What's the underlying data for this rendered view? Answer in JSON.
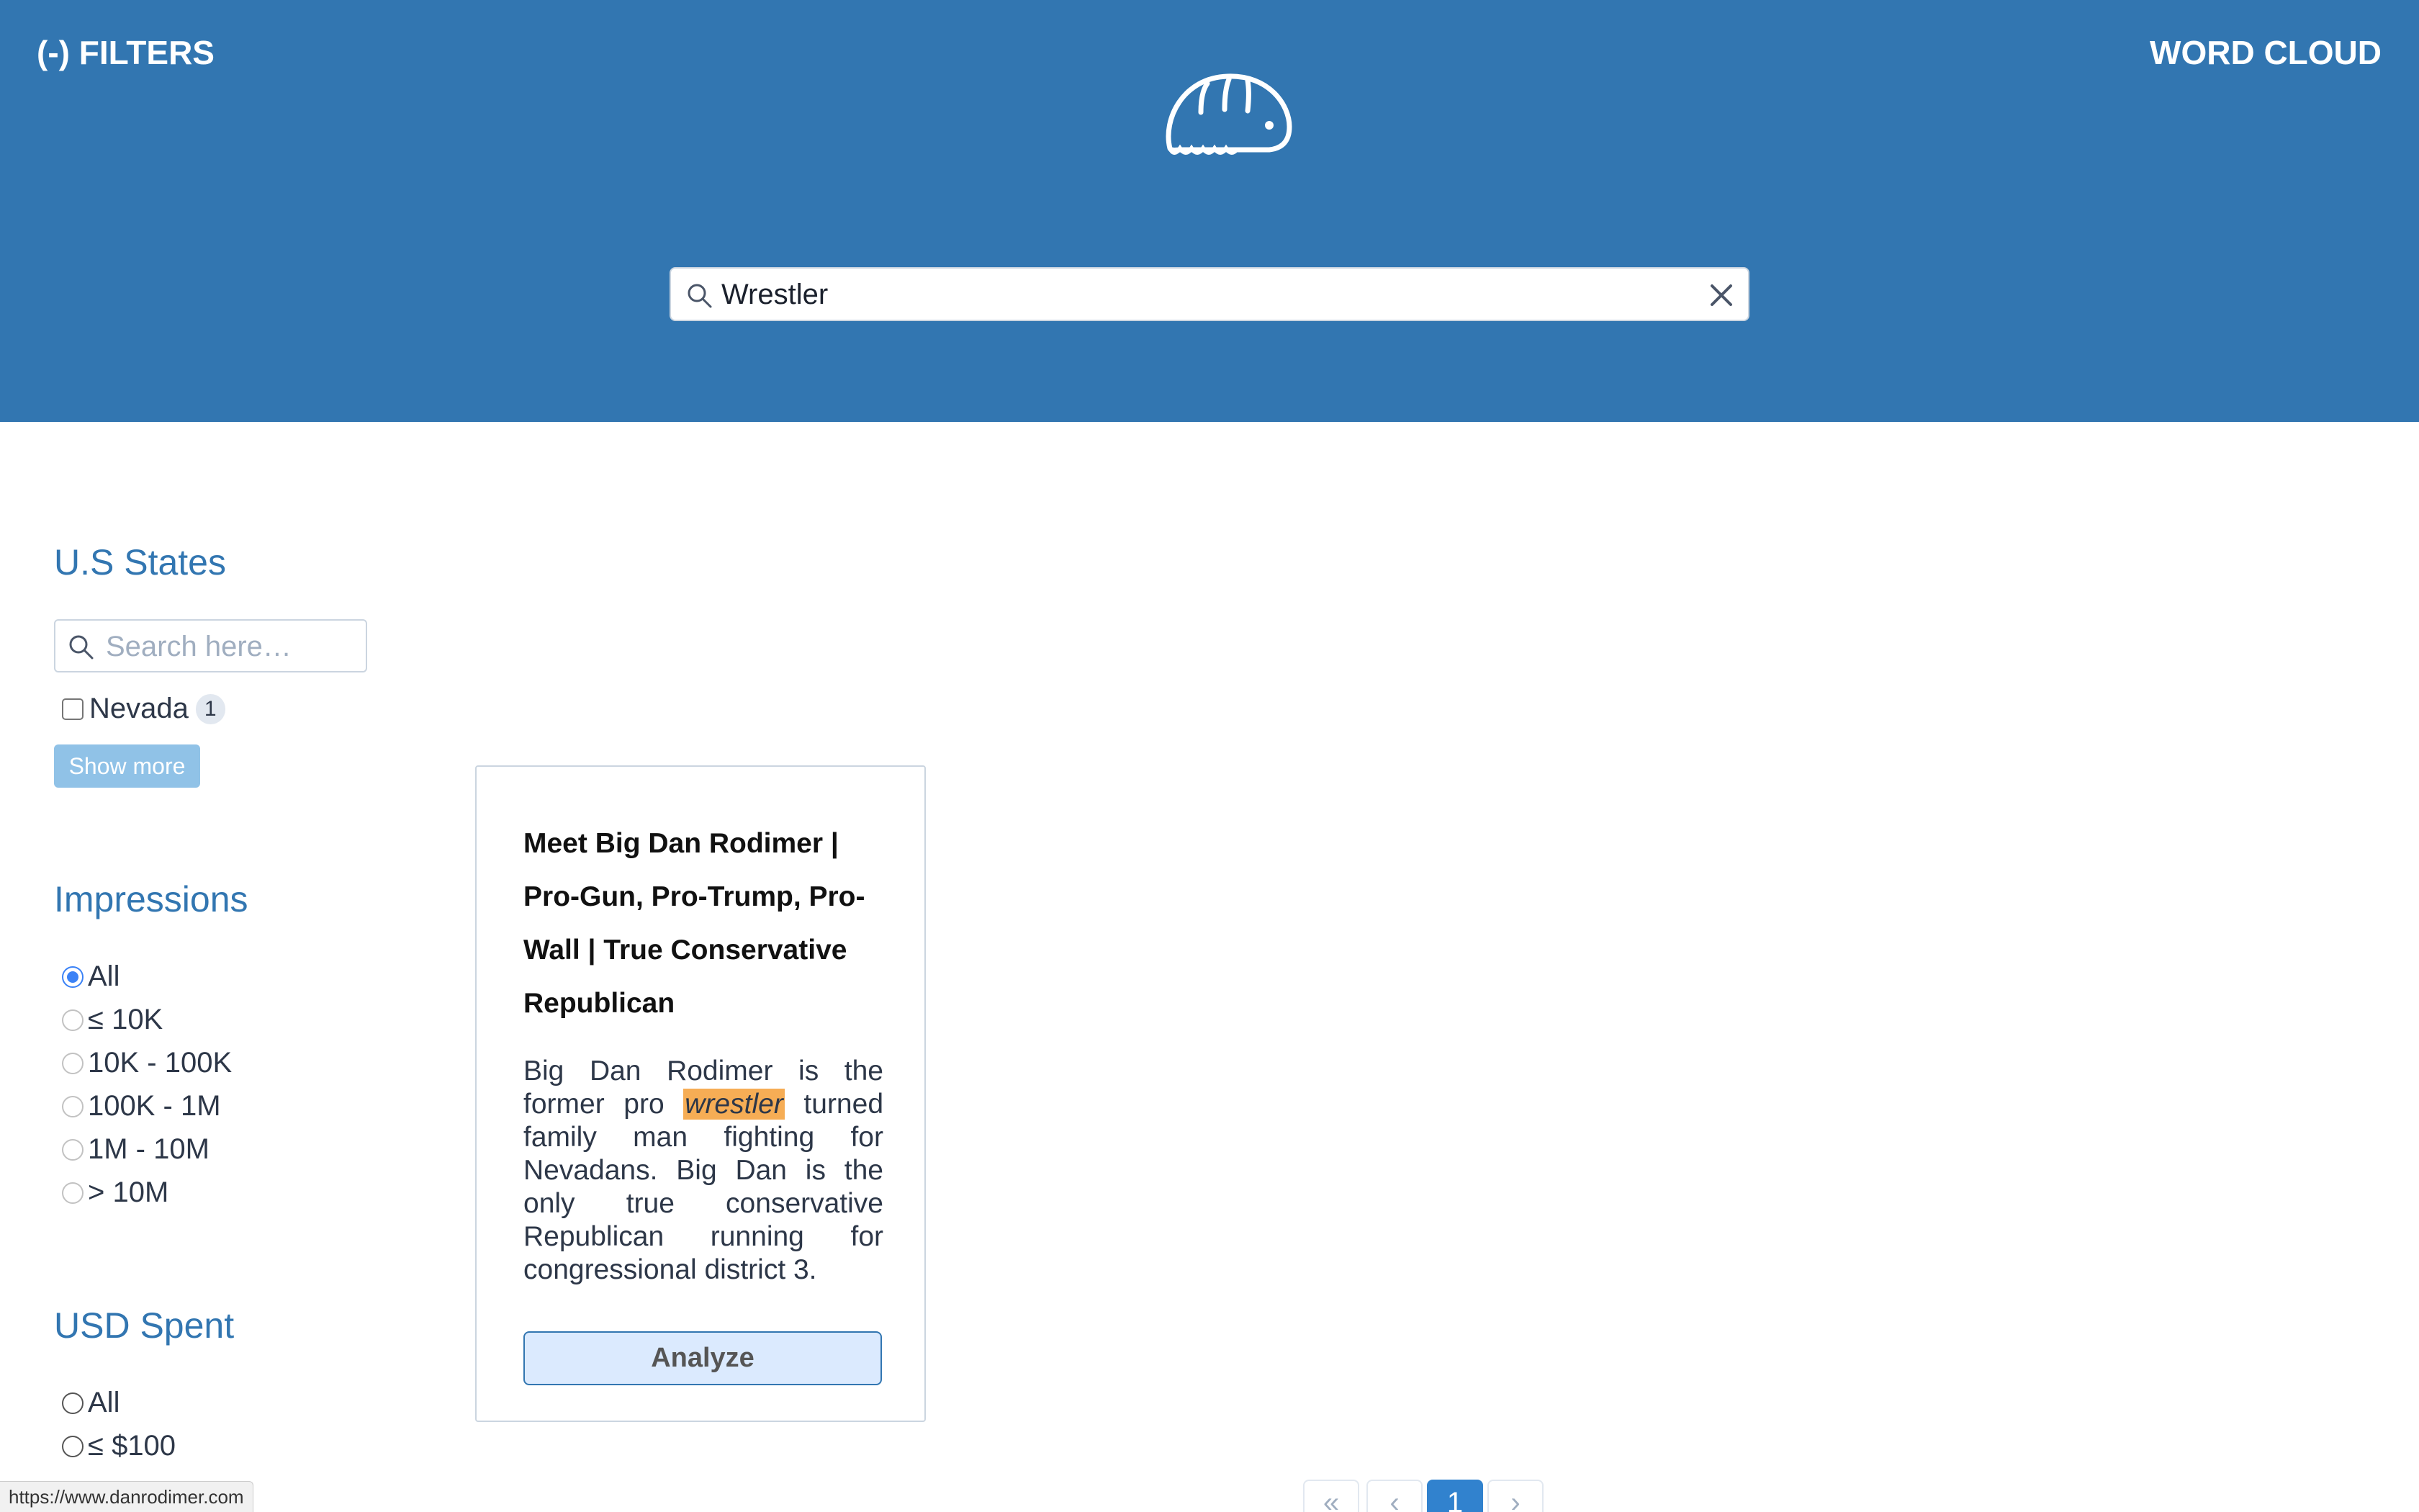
{
  "header": {
    "filters_label": "(-) FILTERS",
    "wordcloud_label": "WORD CLOUD",
    "logo_icon": "armadillo-logo",
    "search": {
      "value": "Wrestler",
      "icon": "search-icon",
      "clear_icon": "close-icon"
    }
  },
  "sidebar": {
    "states": {
      "title": "U.S States",
      "search_placeholder": "Search here…",
      "items": [
        {
          "label": "Nevada",
          "count": "1",
          "checked": false
        }
      ],
      "show_more": "Show more"
    },
    "impressions": {
      "title": "Impressions",
      "options": [
        "All",
        "≤ 10K",
        "10K - 100K",
        "100K - 1M",
        "1M - 10M",
        "> 10M"
      ],
      "selected": "All"
    },
    "usd_spent": {
      "title": "USD Spent",
      "options": [
        "All",
        "≤ $100"
      ]
    }
  },
  "results": [
    {
      "title": "Meet Big Dan Rodimer | Pro-Gun, Pro-Trump, Pro-Wall | True Conservative Republican",
      "body_before": "Big Dan Rodimer is the former pro ",
      "body_highlight": "wrestler",
      "body_after": " turned family man fighting for Nevadans. Big Dan is the only true conservative Republican running for congressional district 3.",
      "analyze_label": "Analyze"
    }
  ],
  "pagination": {
    "first": "«",
    "prev": "‹",
    "current": "1",
    "next": "›"
  },
  "status_bar": {
    "url": "https://www.danrodimer.com"
  },
  "colors": {
    "header_bg": "#3276b1",
    "accent": "#3276b1",
    "highlight": "#f6ad55",
    "active_page": "#3182ce"
  }
}
